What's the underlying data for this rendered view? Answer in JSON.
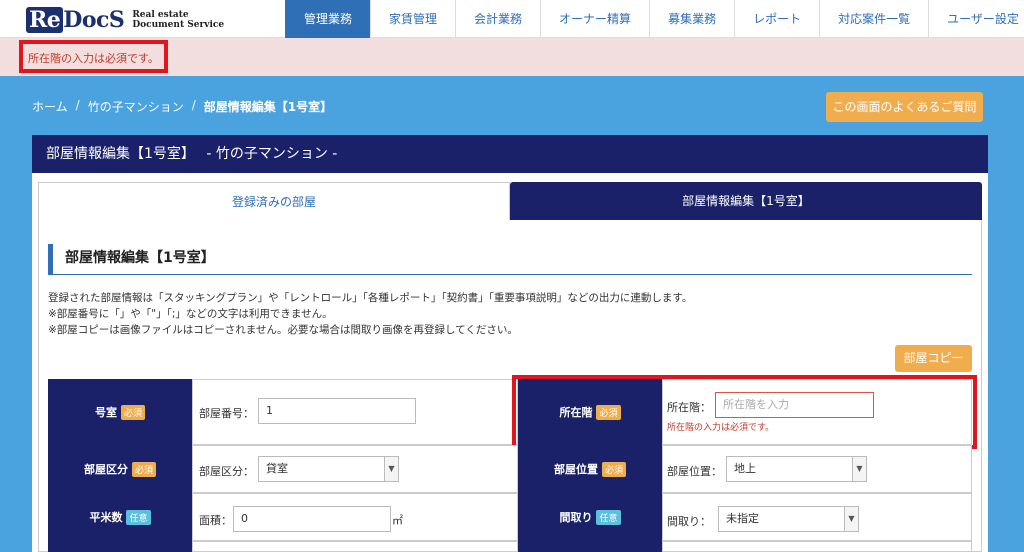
{
  "logo": {
    "re": "Re",
    "docs": "DocS",
    "sub_line1": "Real estate",
    "sub_line2": "Document Service"
  },
  "nav": [
    "管理業務",
    "家賃管理",
    "会計業務",
    "オーナー精算",
    "募集業務",
    "レポート",
    "対応案件一覧",
    "ユーザー設定"
  ],
  "alert": {
    "message": "所在階の入力は必須です。"
  },
  "breadcrumb": {
    "home": "ホーム",
    "property": "竹の子マンション",
    "current": "部屋情報編集【1号室】",
    "sep": "/"
  },
  "faq_button": "この画面のよくあるご質問",
  "panel": {
    "title": "部屋情報編集【1号室】　 - 竹の子マンション -"
  },
  "tabs": {
    "registered": "登録済みの部屋",
    "edit": "部屋情報編集【1号室】"
  },
  "section_title": "部屋情報編集【1号室】",
  "description": [
    "登録された部屋情報は「スタッキングプラン」や「レントロール」「各種レポート」「契約書」「重要事項説明」などの出力に連動します。",
    "※部屋番号に「」や「\"」「;」などの文字は利用できません。",
    "※部屋コピーは画像ファイルはコピーされません。必要な場合は間取り画像を再登録してください。"
  ],
  "copy_button": "部屋コピー",
  "badges": {
    "required": "必須",
    "optional": "任意"
  },
  "form": {
    "room_no": {
      "header": "号室",
      "label": "部屋番号：",
      "value": "1"
    },
    "floor": {
      "header": "所在階",
      "label": "所在階：",
      "placeholder": "所在階を入力",
      "error": "所在階の入力は必須です。"
    },
    "room_type": {
      "header": "部屋区分",
      "label": "部屋区分：",
      "value": "貸室"
    },
    "position": {
      "header": "部屋位置",
      "label": "部屋位置：",
      "value": "地上"
    },
    "area": {
      "header": "平米数",
      "label": "面積：",
      "value": "0",
      "unit": "㎡"
    },
    "layout": {
      "header": "間取り",
      "label": "間取り：",
      "value": "未指定"
    }
  },
  "colors": {
    "navy": "#1a2168",
    "blue": "#2f6fb5",
    "orange": "#f0ad4e",
    "error": "#e0161e",
    "background": "#4aa3df"
  }
}
